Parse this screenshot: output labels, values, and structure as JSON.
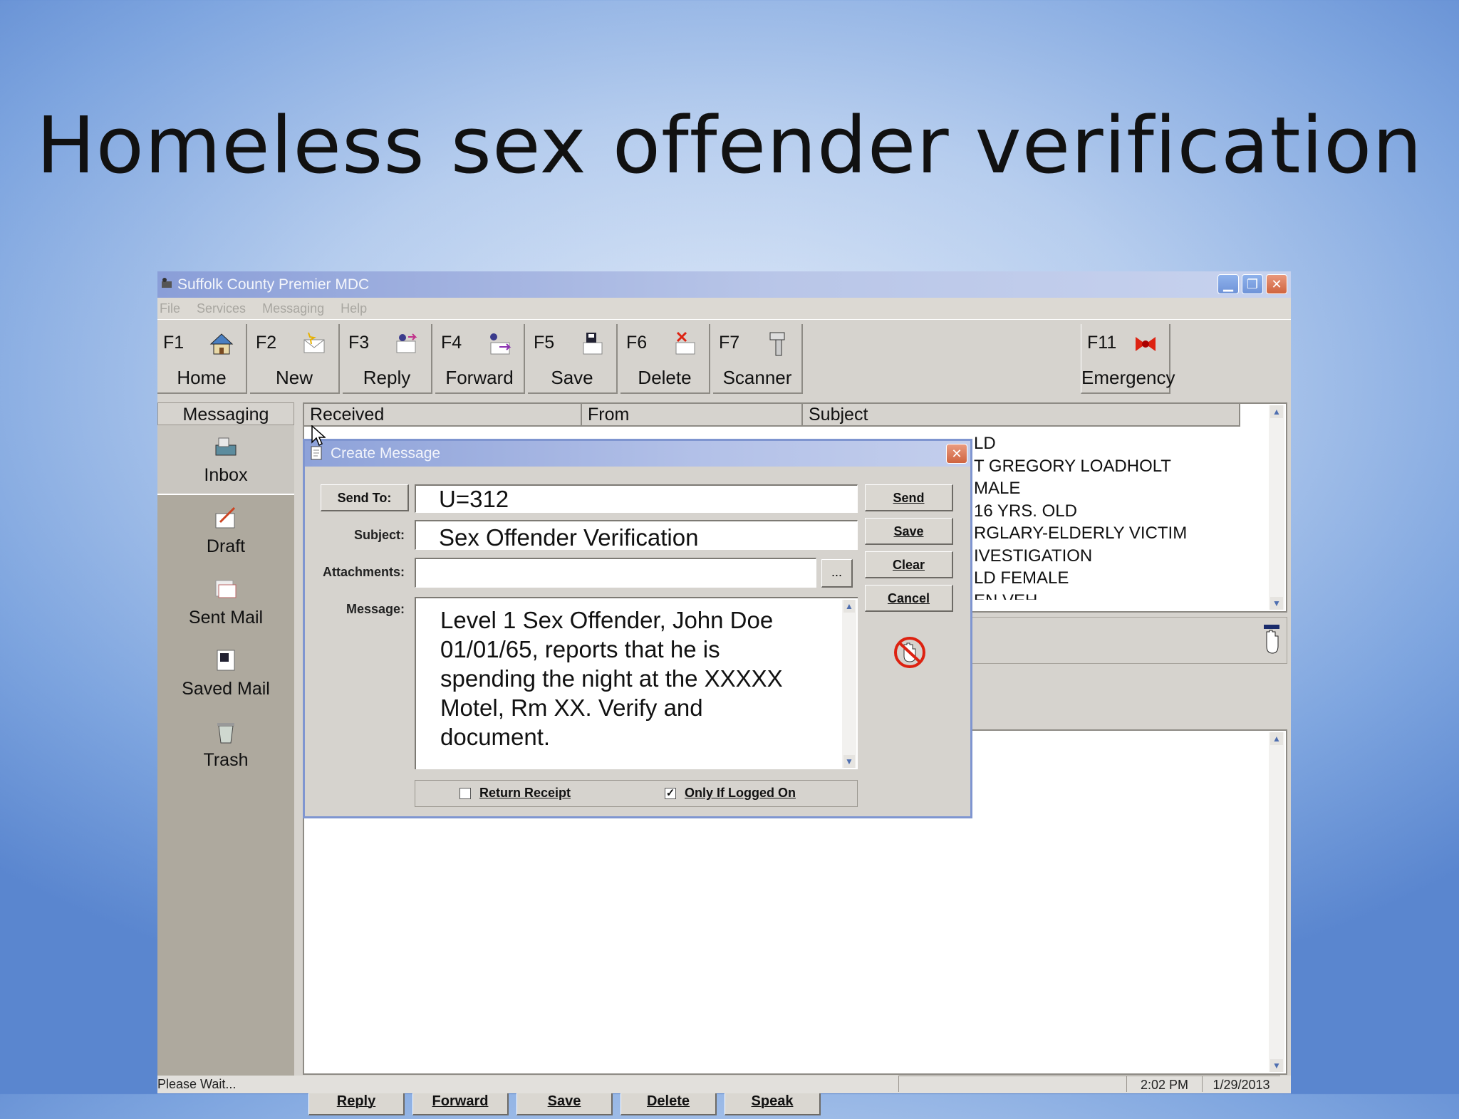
{
  "slide": {
    "title": "Homeless sex offender verification"
  },
  "window": {
    "title": "Suffolk County Premier MDC",
    "menu": [
      "File",
      "Services",
      "Messaging",
      "Help"
    ]
  },
  "toolbar": [
    {
      "key": "F1",
      "label": "Home",
      "icon": "house-icon"
    },
    {
      "key": "F2",
      "label": "New",
      "icon": "new-message-icon"
    },
    {
      "key": "F3",
      "label": "Reply",
      "icon": "reply-icon"
    },
    {
      "key": "F4",
      "label": "Forward",
      "icon": "forward-icon"
    },
    {
      "key": "F5",
      "label": "Save",
      "icon": "save-icon"
    },
    {
      "key": "F6",
      "label": "Delete",
      "icon": "delete-icon"
    },
    {
      "key": "F7",
      "label": "Scanner",
      "icon": "scanner-icon"
    },
    {
      "key": "F11",
      "label": "Emergency",
      "icon": "emergency-icon"
    }
  ],
  "sidebar": {
    "header": "Messaging",
    "items": [
      {
        "label": "Inbox",
        "icon": "inbox-icon"
      },
      {
        "label": "Draft",
        "icon": "draft-icon"
      },
      {
        "label": "Sent Mail",
        "icon": "sent-mail-icon"
      },
      {
        "label": "Saved Mail",
        "icon": "saved-mail-icon"
      },
      {
        "label": "Trash",
        "icon": "trash-icon"
      }
    ]
  },
  "message_list": {
    "columns": [
      "Received",
      "From",
      "Subject"
    ],
    "subjects_visible": [
      "LD",
      "T GREGORY LOADHOLT",
      "MALE",
      "16 YRS. OLD",
      "RGLARY-ELDERLY VICTIM",
      "IVESTIGATION",
      "LD FEMALE",
      "EN VEH"
    ]
  },
  "dialog": {
    "title": "Create Message",
    "send_to_label": "Send To:",
    "send_to_value": "U=312",
    "subject_label": "Subject:",
    "subject_value": "Sex Offender Verification",
    "attachments_label": "Attachments:",
    "attachments_value": "",
    "browse_label": "...",
    "message_label": "Message:",
    "message_value": "Level 1 Sex Offender, John Doe\n01/01/65, reports that he is\nspending the night at the XXXXX\nMotel, Rm XX. Verify and\ndocument.",
    "buttons": [
      "Send",
      "Save",
      "Clear",
      "Cancel"
    ],
    "return_receipt_label": "Return Receipt",
    "return_receipt_checked": false,
    "only_if_logged_on_label": "Only If Logged On",
    "only_if_logged_on_checked": true,
    "check_mark": "✓"
  },
  "bottom_buttons": [
    "Reply",
    "Forward",
    "Save",
    "Delete",
    "Speak"
  ],
  "status": {
    "text": "Please Wait...",
    "time": "2:02 PM",
    "date": "1/29/2013"
  },
  "colors": {
    "background": "#7ea5df",
    "titlebar": "#8a9ed8",
    "window_face": "#d6d3ce"
  }
}
